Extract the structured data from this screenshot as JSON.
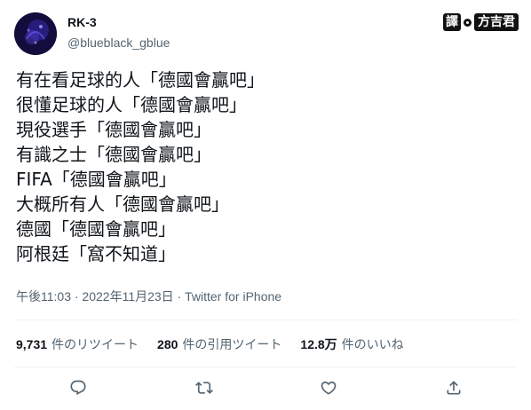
{
  "author": {
    "display_name": "RK-3",
    "handle": "@blueblack_gblue"
  },
  "watermark": {
    "badge": "譯",
    "name": "方吉君"
  },
  "tweet_lines": [
    "有在看足球的人「德國會贏吧」",
    "很懂足球的人「德國會贏吧」",
    "現役選手「德國會贏吧」",
    "有識之士「德國會贏吧」",
    "FIFA「德國會贏吧」",
    "大概所有人「德國會贏吧」",
    "德國「德國會贏吧」",
    "阿根廷「窩不知道」"
  ],
  "meta": {
    "timestamp": "午後11:03 · 2022年11月23日",
    "separator": " · ",
    "source": "Twitter for iPhone"
  },
  "stats": {
    "retweets_count": "9,731",
    "retweets_label": "件のリツイート",
    "quotes_count": "280",
    "quotes_label": "件の引用ツイート",
    "likes_count": "12.8万",
    "likes_label": "件のいいね"
  },
  "actions": {
    "reply_icon": "reply-icon",
    "retweet_icon": "retweet-icon",
    "like_icon": "heart-icon",
    "share_icon": "share-icon"
  },
  "colors": {
    "text_primary": "#0f1419",
    "text_secondary": "#536471",
    "divider": "#eff3f4"
  }
}
